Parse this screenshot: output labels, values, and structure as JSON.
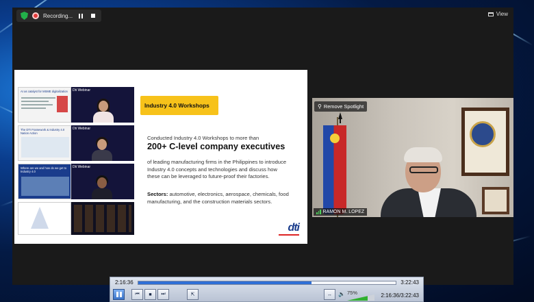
{
  "zoom": {
    "recording_label": "Recording...",
    "view_label": "View"
  },
  "slide": {
    "banner": "Industry 4.0 Workshops",
    "intro": "Conducted Industry 4.0 Workshops to more than",
    "headline": "200+ C-level company executives",
    "description": "of leading manufacturing firms in the Philippines to introduce Industry 4.0 concepts and technologies and discuss how these can be leveraged to future-proof their factories.",
    "sectors_label": "Sectors:",
    "sectors_text": " automotive, electronics, aerospace, chemicals, food manufacturing, and the construction materials sectors.",
    "logo_text": "dti",
    "thumbnails": [
      {
        "left_title": "AI as catalyst for MSME digitalization",
        "right_title": "Dti Webinar"
      },
      {
        "left_title": "The DTI Framework & Industry 4.0 Nation Action",
        "right_title": "Dti Webinar"
      },
      {
        "left_title": "Where are we and how do we get to Industry 4.0",
        "right_title": "Dti Webinar"
      },
      {
        "left_title": "",
        "right_title": ""
      }
    ]
  },
  "camera": {
    "spotlight_label": "Remove Spotlight",
    "participant_name": "RAMON M. LOPEZ"
  },
  "player": {
    "current_time": "2:16:36",
    "total_time": "3:22:43",
    "progress": 0.673,
    "volume_percent": "75%",
    "volume_level": 0.75,
    "time_readout": "2:16:36/3:22:43"
  }
}
